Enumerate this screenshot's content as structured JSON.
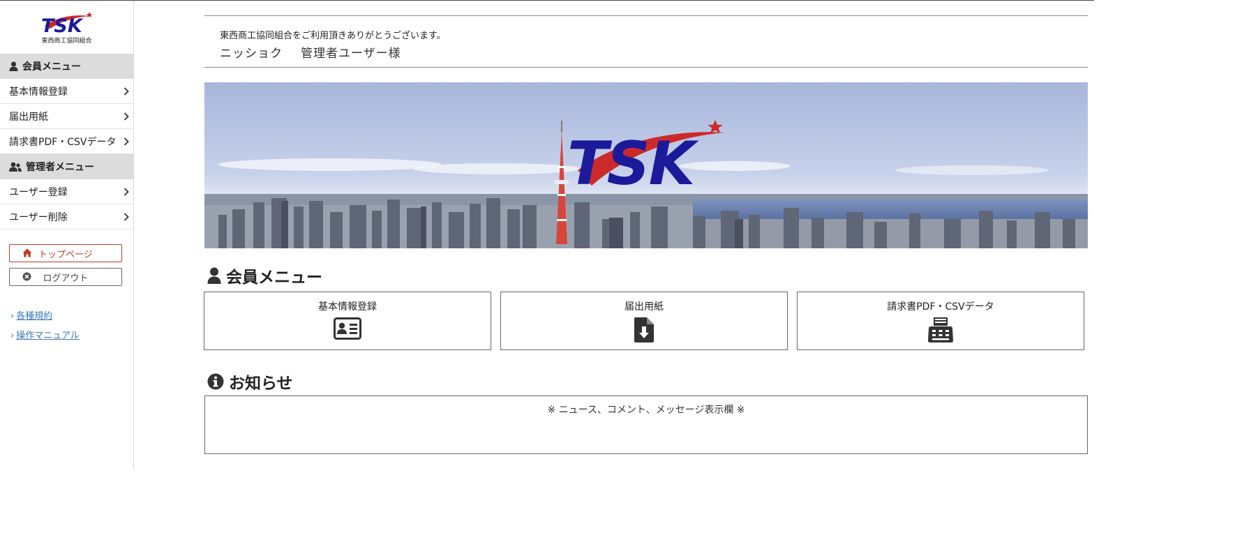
{
  "brand": {
    "logo_text": "TSK",
    "subtitle": "東西商工協同組合",
    "colors": {
      "navy": "#1a1a9a",
      "red": "#cc2a2a"
    }
  },
  "sidebar": {
    "member_menu": {
      "title": "会員メニュー",
      "icon": "user-icon",
      "items": [
        {
          "label": "基本情報登録"
        },
        {
          "label": "届出用紙"
        },
        {
          "label": "請求書PDF・CSVデータ"
        }
      ]
    },
    "admin_menu": {
      "title": "管理者メニュー",
      "icon": "users-icon",
      "items": [
        {
          "label": "ユーザー登録"
        },
        {
          "label": "ユーザー削除"
        }
      ]
    },
    "top_button": {
      "label": "トップページ",
      "icon": "home-icon"
    },
    "logout_button": {
      "label": "ログアウト",
      "icon": "close-circle-icon"
    },
    "links": [
      {
        "label": "各種規約"
      },
      {
        "label": "操作マニュアル"
      }
    ]
  },
  "greeting": {
    "line1": "東西商工協同組合をご利用頂きありがとうございます。",
    "company": "ニッショク",
    "user": "管理者ユーザー様"
  },
  "member_section": {
    "title": "会員メニュー",
    "cards": [
      {
        "label": "基本情報登録",
        "icon": "id-card-icon"
      },
      {
        "label": "届出用紙",
        "icon": "file-download-icon"
      },
      {
        "label": "請求書PDF・CSVデータ",
        "icon": "fax-icon"
      }
    ]
  },
  "news_section": {
    "title": "お知らせ",
    "icon": "info-circle-icon",
    "placeholder": "※ ニュース、コメント、メッセージ表示欄 ※"
  }
}
